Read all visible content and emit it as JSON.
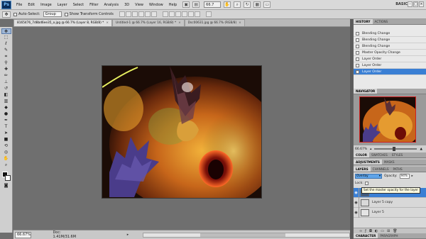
{
  "menubar": {
    "logo": "Ps",
    "items": [
      "File",
      "Edit",
      "Image",
      "Layer",
      "Select",
      "Filter",
      "Analysis",
      "3D",
      "View",
      "Window",
      "Help"
    ],
    "zoom": "66.7",
    "workspace": "BASIC"
  },
  "options": {
    "auto_select_label": "Auto-Select:",
    "auto_select_value": "Group",
    "show_transform_label": "Show Transform Controls"
  },
  "tabs": [
    {
      "label": "8165476_7d8bd6ee35_o.jpg @ 66.7% (Layer 8, RGB/8) *",
      "active": true
    },
    {
      "label": "Untitled-1 @ 66.7% (Layer 16, RGB/8) *",
      "active": false
    },
    {
      "label": "Dsc00631.jpg @ 66.7% (RGB/8)",
      "active": false
    }
  ],
  "status": {
    "zoom": "66.67%",
    "doc": "Doc: 1.41M/31.6M"
  },
  "history": {
    "tabs": [
      "HISTORY",
      "ACTIONS"
    ],
    "items": [
      {
        "label": "Blending Change",
        "active": false
      },
      {
        "label": "Blending Change",
        "active": false
      },
      {
        "label": "Blending Change",
        "active": false
      },
      {
        "label": "Master Opacity Change",
        "active": false
      },
      {
        "label": "Layer Order",
        "active": false
      },
      {
        "label": "Layer Order",
        "active": false
      },
      {
        "label": "Layer Order",
        "active": true
      }
    ]
  },
  "navigator": {
    "tab": "NAVIGATOR",
    "zoom": "66.67%"
  },
  "color_tabs": [
    "COLOR",
    "SWATCHES",
    "STYLES"
  ],
  "adjust_tabs": [
    "ADJUSTMENTS",
    "MASKS"
  ],
  "layers": {
    "tabs": [
      "LAYERS",
      "CHANNELS",
      "PATHS"
    ],
    "blend_mode": "Overlay",
    "opacity_label": "Opacity:",
    "opacity_value": "94%",
    "lock_label": "Lock:",
    "tooltip": "Set the master opacity for the layer",
    "rows": [
      {
        "name": "Layer 8",
        "active": true
      },
      {
        "name": "Layer 5 copy",
        "active": false
      },
      {
        "name": "Layer 5",
        "active": false
      }
    ]
  },
  "char_tabs": [
    "CHARACTER",
    "PARAGRAPH"
  ]
}
